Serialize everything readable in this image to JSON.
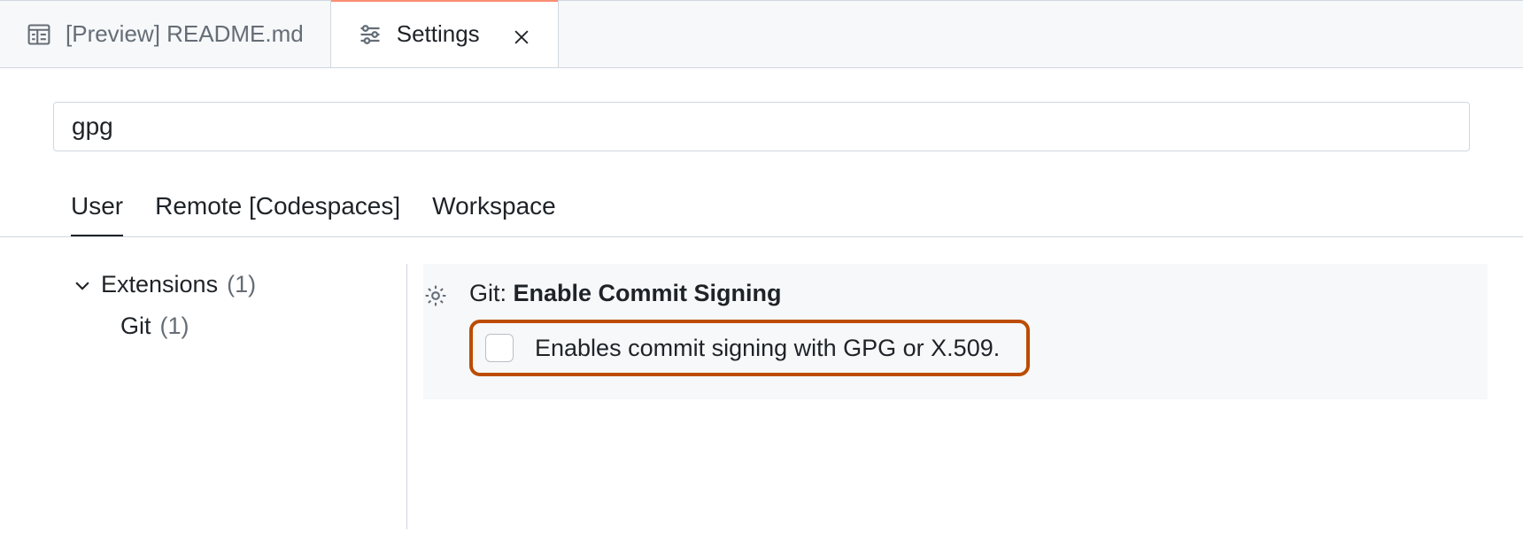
{
  "tabs": {
    "readme": {
      "label": "[Preview] README.md"
    },
    "settings": {
      "label": "Settings"
    }
  },
  "search": {
    "value": "gpg"
  },
  "scopes": {
    "user": "User",
    "remote": "Remote [Codespaces]",
    "workspace": "Workspace"
  },
  "tree": {
    "extensions": {
      "label": "Extensions",
      "count": "(1)"
    },
    "git": {
      "label": "Git",
      "count": "(1)"
    }
  },
  "setting": {
    "title_prefix": "Git: ",
    "title_name": "Enable Commit Signing",
    "description": "Enables commit signing with GPG or X.509."
  }
}
